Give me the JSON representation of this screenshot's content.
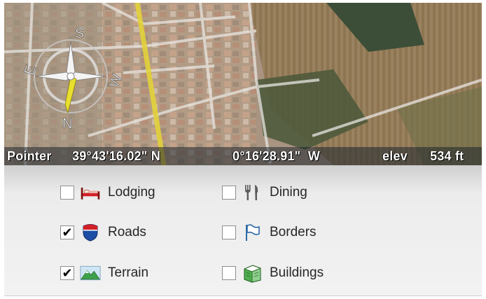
{
  "map": {
    "compass": {
      "north": "N",
      "south": "S",
      "east": "E",
      "west": "W"
    }
  },
  "status": {
    "label": "Pointer",
    "latitude": "39°43'16.02\" N",
    "longitude": "0°16'28.91\"  W",
    "elev_label": "elev",
    "elevation": "534 ft"
  },
  "layers": [
    {
      "label": "Lodging",
      "checked": false,
      "icon": "bed-icon"
    },
    {
      "label": "Roads",
      "checked": true,
      "icon": "interstate-shield-icon"
    },
    {
      "label": "Terrain",
      "checked": true,
      "icon": "mountain-icon"
    },
    {
      "label": "Dining",
      "checked": false,
      "icon": "fork-knife-icon"
    },
    {
      "label": "Borders",
      "checked": false,
      "icon": "flag-icon"
    },
    {
      "label": "Buildings",
      "checked": false,
      "icon": "building-icon"
    }
  ],
  "colors": {
    "road_yellow": "#e2d23a",
    "checkbox_border": "#8e8e8e",
    "compass_needle": "#e8e02c",
    "shield_red": "#d32027",
    "shield_blue": "#1c4ea6",
    "terrain_green": "#3fa04a"
  }
}
